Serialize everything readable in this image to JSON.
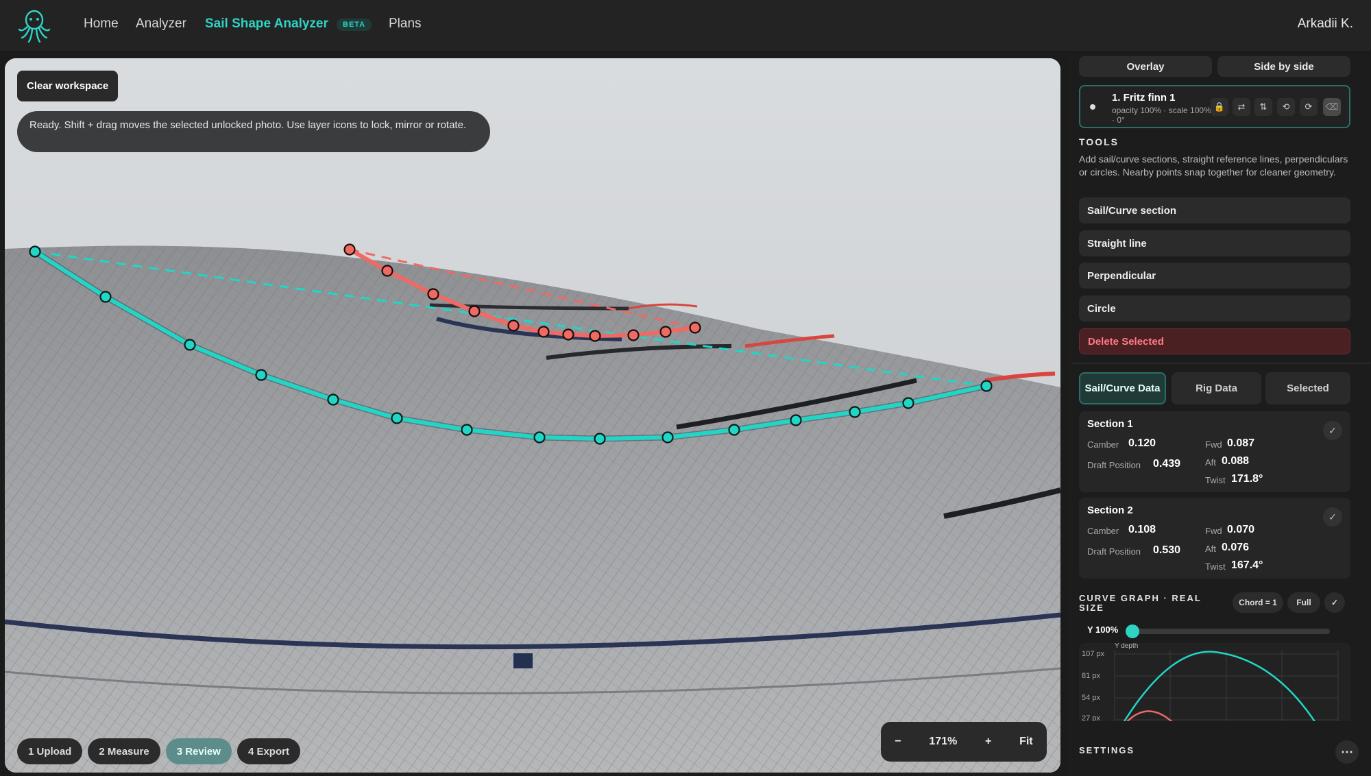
{
  "nav": {
    "links": [
      "Home",
      "Analyzer",
      "Sail Shape Analyzer",
      "Plans"
    ],
    "beta": "BETA",
    "user": "Arkadii K."
  },
  "canvas": {
    "clear_label": "Clear workspace",
    "status": "Ready. Shift + drag moves the selected unlocked photo. Use layer icons to lock, mirror or rotate.",
    "steps": [
      "1 Upload",
      "2 Measure",
      "3 Review",
      "4 Export"
    ],
    "active_step": "3 Review",
    "zoom": {
      "minus": "−",
      "value": "171%",
      "plus": "+",
      "fit": "Fit"
    }
  },
  "panel": {
    "view_modes": [
      "Overlay",
      "Side by side"
    ],
    "layer": {
      "title": "1. Fritz finn 1",
      "subtitle": "opacity 100% · scale 100% · 0°"
    },
    "tools_heading": "TOOLS",
    "tools_desc": "Add sail/curve sections, straight reference lines, perpendiculars or circles. Nearby points snap together for cleaner geometry.",
    "tools": [
      "Sail/Curve section",
      "Straight line",
      "Perpendicular",
      "Circle"
    ],
    "delete_label": "Delete Selected",
    "data_tabs": [
      "Sail/Curve Data",
      "Rig Data",
      "Selected"
    ],
    "labels": {
      "camber": "Camber",
      "draft": "Draft Position",
      "fwd": "Fwd",
      "aft": "Aft",
      "twist": "Twist"
    },
    "sections": [
      {
        "name": "Section 1",
        "camber": "0.120",
        "draft": "0.439",
        "fwd": "0.087",
        "aft": "0.088",
        "twist": "171.8°"
      },
      {
        "name": "Section 2",
        "camber": "0.108",
        "draft": "0.530",
        "fwd": "0.070",
        "aft": "0.076",
        "twist": "167.4°"
      }
    ],
    "graph": {
      "heading": "CURVE GRAPH · REAL SIZE",
      "chord_btn": "Chord = 1",
      "full_btn": "Full",
      "y_label": "Y 100%",
      "axis_title": "Y depth",
      "y_ticks": [
        "107 px",
        "81 px",
        "54 px",
        "27 px"
      ]
    },
    "settings": "SETTINGS",
    "colors": {
      "accent": "#2fd3c4",
      "curve_teal": "#22d6c6",
      "curve_red": "#f06a64"
    }
  }
}
